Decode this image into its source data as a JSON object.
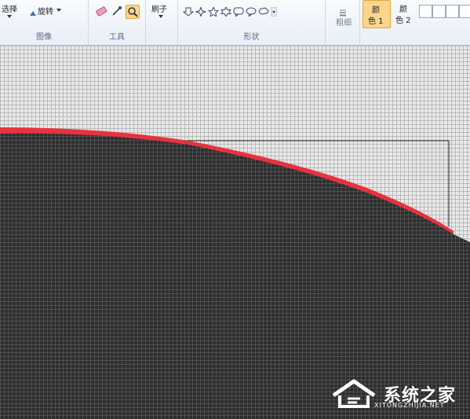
{
  "ribbon": {
    "image_group": {
      "select_label": "选择",
      "rotate_label": "旋转",
      "group_label": "图像"
    },
    "tools_group": {
      "group_label": "工具"
    },
    "brush_group": {
      "brush_label": "刷子"
    },
    "shapes_group": {
      "group_label": "形状"
    },
    "size_group": {
      "size_label": "粗细"
    },
    "colors_group": {
      "color1_label_line1": "颜",
      "color1_label_line2": "色 1",
      "color2_label_line1": "颜",
      "color2_label_line2": "色 2"
    }
  },
  "colors": {
    "canvas_fill": "#2b2b2b",
    "brush_red": "#e8323e",
    "color1_highlight": "#fbd58a"
  },
  "watermark": {
    "title": "系统之家",
    "subtitle": "XITONGZHIJIA.NET"
  }
}
